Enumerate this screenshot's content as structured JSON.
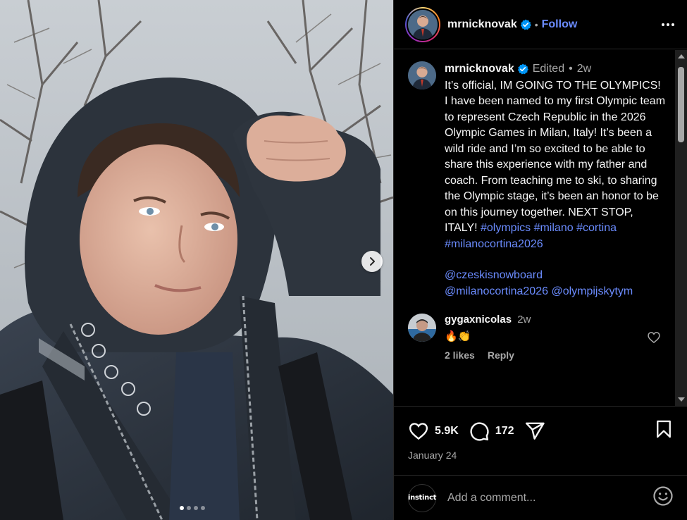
{
  "post": {
    "author": "mrnicknovak",
    "follow_label": "Follow",
    "separator": "•",
    "carousel_total": 4,
    "carousel_index": 1
  },
  "caption": {
    "username": "mrnicknovak",
    "edited": "Edited",
    "dot": "•",
    "time": "2w",
    "text": "It’s official, IM GOING TO THE OLYMPICS! I have been named to my first Olympic team to represent Czech Republic in the 2026 Olympic Games in Milan, Italy! It’s been a wild ride and I’m so excited to be able to share this experience with my father and coach. From teaching me to ski, to sharing the Olympic stage, it’s been an honor to be on this journey together. NEXT STOP, ITALY! ",
    "hashtags": [
      "#olympics",
      "#milano",
      "#cortina",
      "#milanocortina2026"
    ],
    "mentions": [
      "@czeskisnowboard",
      "@milanocortina2026",
      "@olympijskytym"
    ]
  },
  "comment": {
    "username": "gygaxnicolas",
    "time": "2w",
    "text": "🔥👏",
    "likes": "2 likes",
    "reply": "Reply"
  },
  "actions": {
    "likes": "5.9K",
    "comments": "172",
    "date": "January 24"
  },
  "add_comment": {
    "avatar_text": "instinct",
    "placeholder": "Add a comment..."
  },
  "colors": {
    "link": "#6b8cff",
    "verified": "#0095f6",
    "muted": "#a8a8a8"
  },
  "icons": [
    "chevron-right-icon",
    "verified-icon",
    "more-icon",
    "heart-icon",
    "comment-icon",
    "share-icon",
    "bookmark-icon",
    "emoji-icon"
  ]
}
